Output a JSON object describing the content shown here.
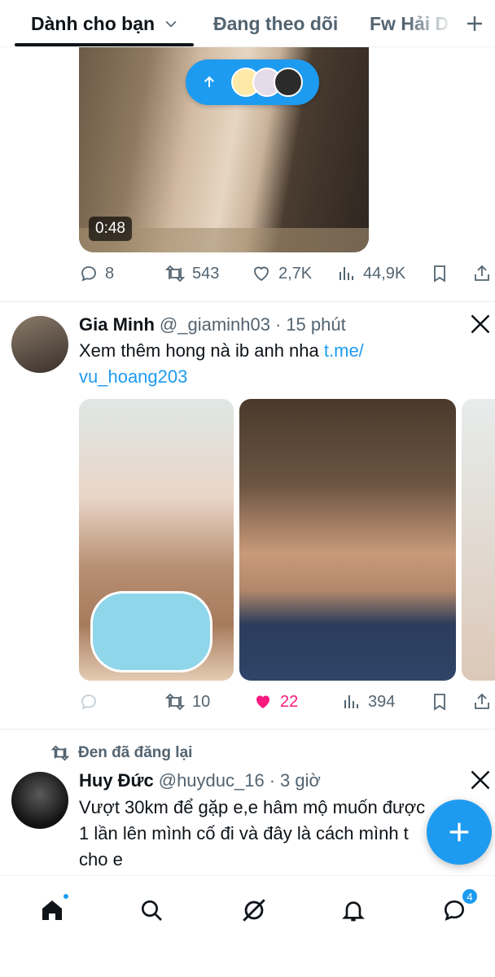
{
  "tabs": [
    {
      "label": "Dành cho bạn",
      "active": true
    },
    {
      "label": "Đang theo dõi",
      "active": false
    },
    {
      "label": "Fw Hải D",
      "active": false
    }
  ],
  "post1": {
    "video_duration": "0:48",
    "stats": {
      "replies": "8",
      "reposts": "543",
      "likes": "2,7K",
      "views": "44,9K"
    }
  },
  "post2": {
    "display_name": "Gia Minh",
    "handle": "@_giaminh03",
    "time": "15 phút",
    "text": "Xem thêm hong nà ib anh nha ",
    "link_text_1": "t.me/",
    "link_text_2": "vu_hoang203",
    "stats": {
      "replies": "",
      "reposts": "10",
      "likes": "22",
      "views": "394"
    }
  },
  "post3": {
    "repost_label": "Đen đã đăng lại",
    "display_name": "Huy Đức",
    "handle": "@huyduc_16",
    "time": "3 giờ",
    "text_line1": "Vượt 30km để gặp e,e hâm mộ muốn được",
    "text_line2": "1 lần lên mình cố đi và đây là cách mình t",
    "text_line3": "cho e"
  },
  "bottom_nav": {
    "items": [
      "home",
      "search",
      "grok",
      "notifications",
      "messages"
    ],
    "messages_badge": "4"
  },
  "colors": {
    "accent": "#1d9bf0",
    "like": "#f91880",
    "text": "#0f1419",
    "muted": "#536471"
  }
}
